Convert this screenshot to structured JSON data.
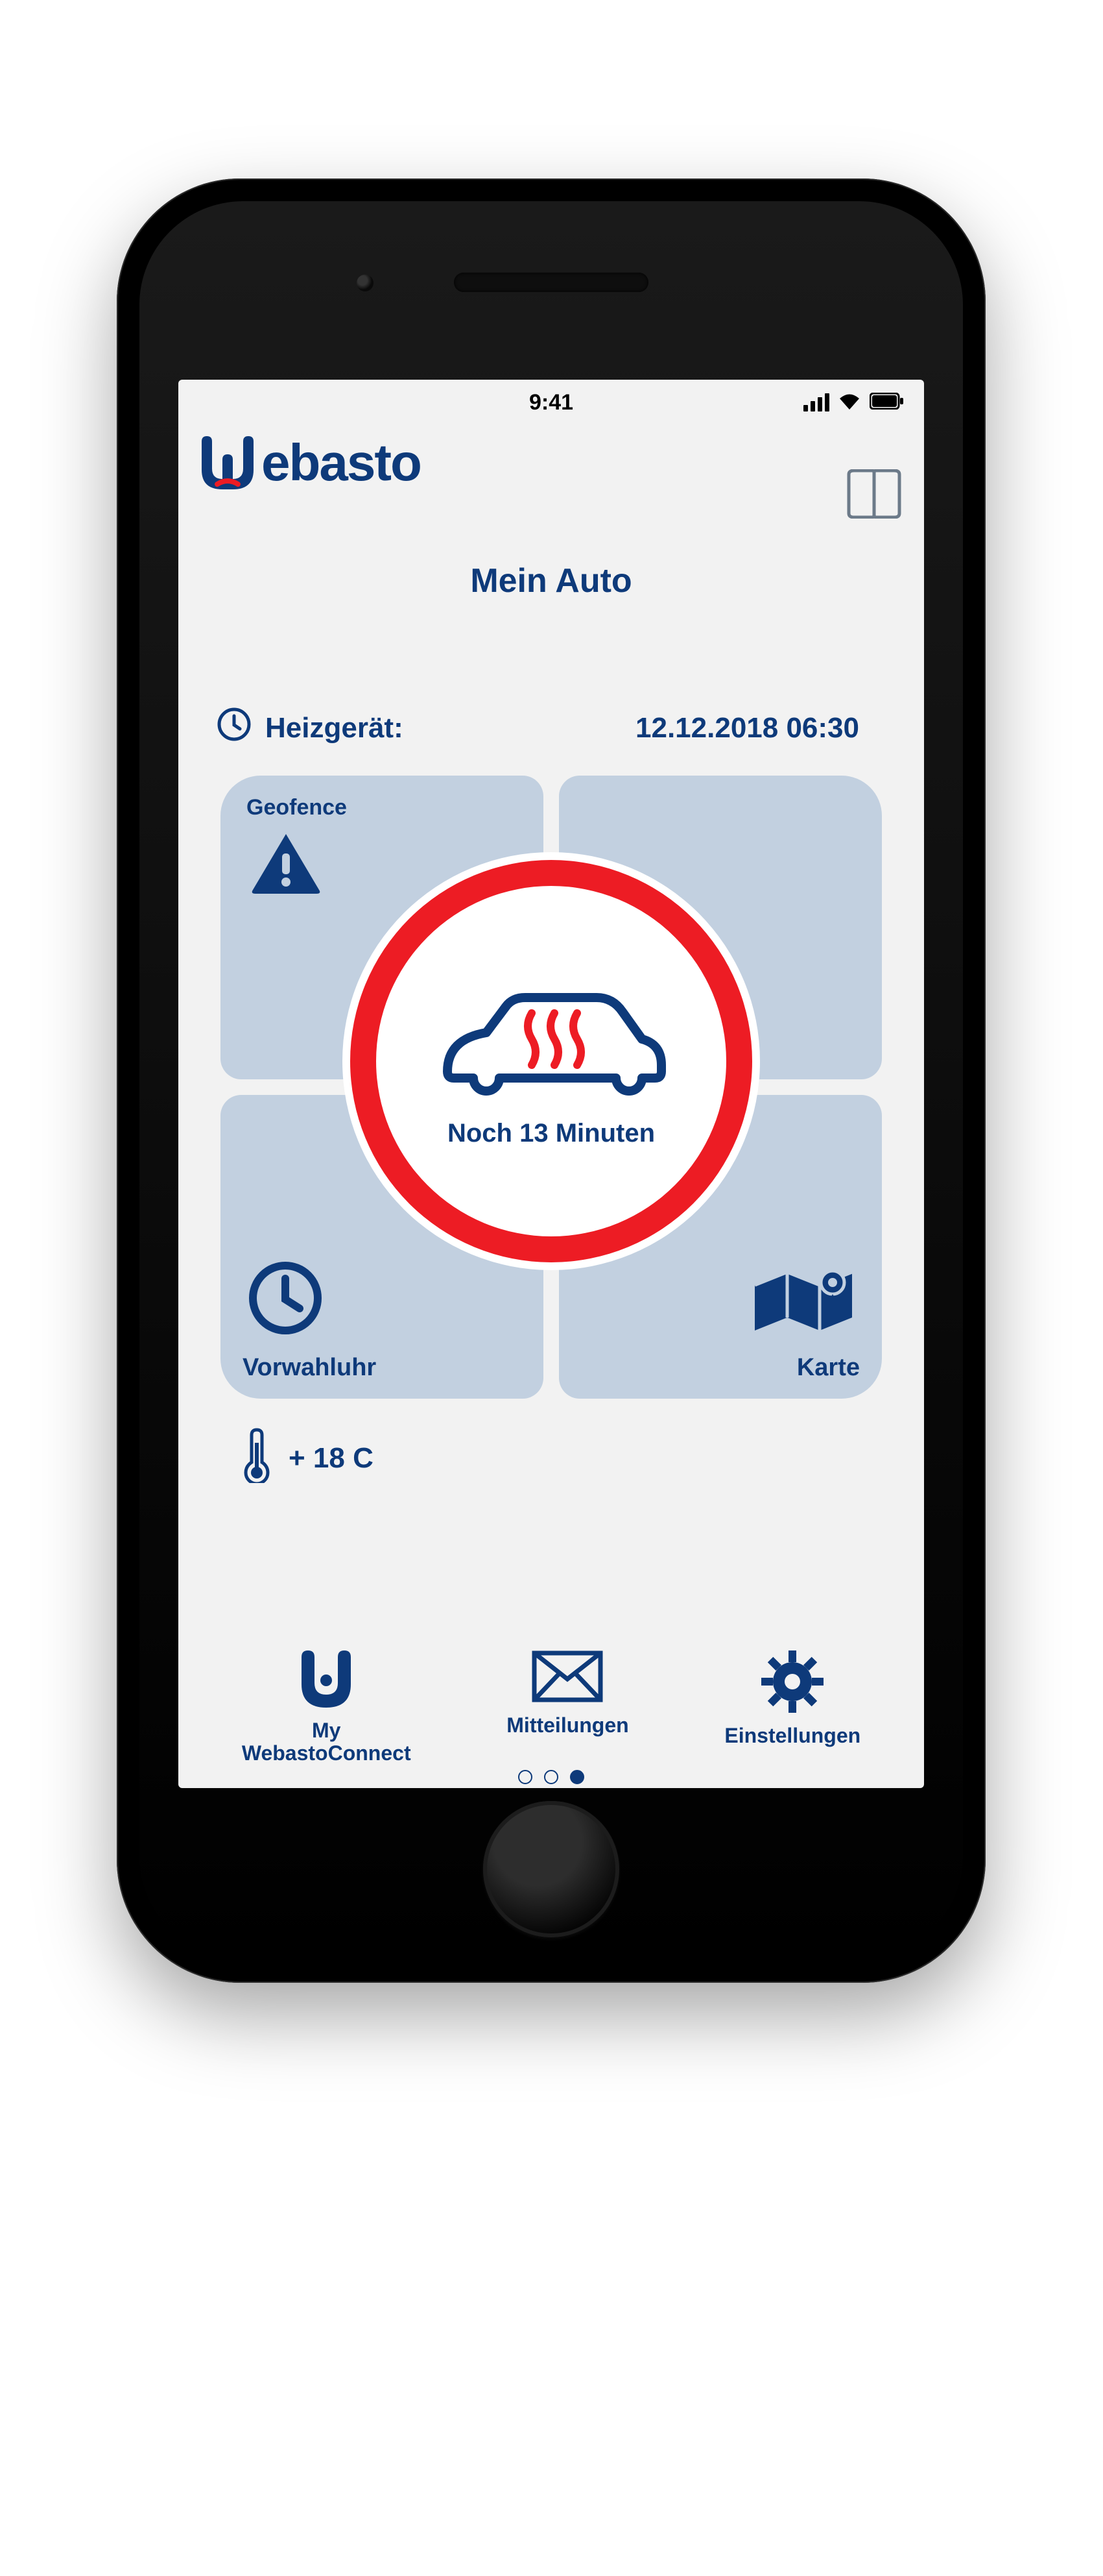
{
  "status_bar": {
    "time": "9:41"
  },
  "brand": "ebasto",
  "page_title": "Mein Auto",
  "heater": {
    "label": "Heizgerät:",
    "value": "12.12.2018 06:30"
  },
  "tiles": {
    "geofence": "Geofence",
    "timer": "Vorwahluhr",
    "map": "Karte"
  },
  "center_status": "Noch 13 Minuten",
  "temperature": "+ 18 C",
  "bottom": {
    "connect_line1": "My",
    "connect_line2": "WebastoConnect",
    "messages": "Mitteilungen",
    "settings": "Einstellungen"
  }
}
